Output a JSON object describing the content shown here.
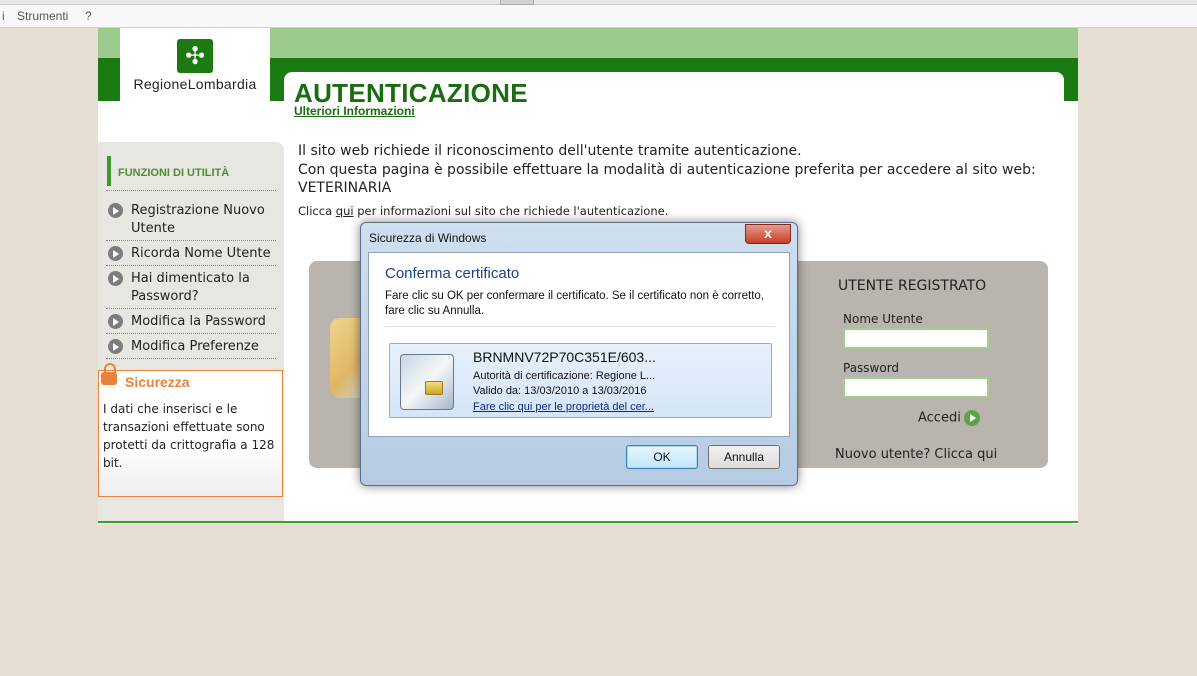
{
  "browser_menu": {
    "item_i": "i",
    "strumenti": "Strumenti",
    "help": "?"
  },
  "logo": {
    "name": "RegioneLombardia",
    "symbol": "✣"
  },
  "header": {
    "title": "AUTENTICAZIONE",
    "sublink": "Ulteriori Informazioni"
  },
  "sidebar": {
    "heading": "FUNZIONI DI UTILITÀ",
    "items": [
      {
        "label": "Registrazione Nuovo Utente"
      },
      {
        "label": "Ricorda Nome Utente"
      },
      {
        "label": "Hai dimenticato la Password?"
      },
      {
        "label": "Modifica la Password"
      },
      {
        "label": "Modifica Preferenze"
      }
    ],
    "security": {
      "title": "Sicurezza",
      "text": "I dati che inserisci e le transazioni effettuate sono protetti da crittografia a 128 bit."
    }
  },
  "intro": {
    "line1": "Il sito web richiede il riconoscimento dell'utente tramite autenticazione.",
    "line2": "Con questa pagina è possibile effettuare la modalità di autenticazione preferita per accedere al sito web: VETERINARIA",
    "info_pre": "Clicca ",
    "info_link": "qui",
    "info_post": " per informazioni sul sito che richiede l'autenticazione."
  },
  "login": {
    "heading": "UTENTE REGISTRATO",
    "username_label": "Nome Utente",
    "password_label": "Password",
    "submit_label": "Accedi",
    "new_user": "Nuovo utente? Clicca qui"
  },
  "dialog": {
    "window_title": "Sicurezza di Windows",
    "close_symbol": "x",
    "heading": "Conferma certificato",
    "description": "Fare clic su OK per confermare il certificato. Se il certificato non è corretto, fare clic su Annulla.",
    "certificate": {
      "name": "BRNMNV72P70C351E/603...",
      "authority": "Autorità di certificazione: Regione L...",
      "validity": "Valido da: 13/03/2010 a 13/03/2016",
      "link": "Fare clic qui per le proprietà del cer..."
    },
    "ok_label": "OK",
    "cancel_label": "Annulla"
  }
}
